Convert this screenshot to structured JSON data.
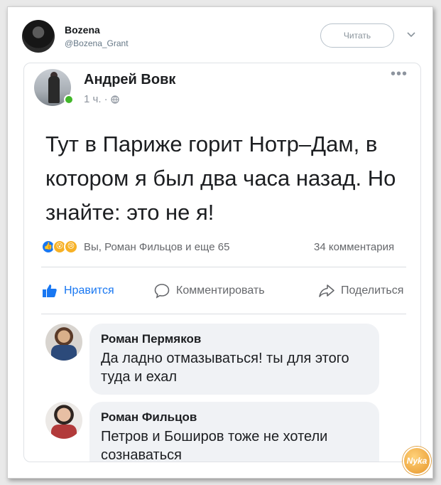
{
  "tweet": {
    "author_name": "Bozena",
    "author_handle": "@Bozena_Grant",
    "follow_label": "Читать"
  },
  "post": {
    "author": "Андрей Вовк",
    "time": "1 ч. ·",
    "text": "Тут в Париже горит Нотр–Дам, в котором я был два часа назад. Но знайте: это не я!",
    "reactions_summary": "Вы, Роман Фильцов и еще 65",
    "comments_count": "34 комментария",
    "actions": {
      "like": "Нравится",
      "comment": "Комментировать",
      "share": "Поделиться"
    }
  },
  "comments": [
    {
      "author": "Роман Пермяков",
      "text": "Да ладно отмазываться! ты для этого туда и ехал"
    },
    {
      "author": "Роман Фильцов",
      "text": "Петров и Боширов тоже не хотели сознаваться"
    }
  ],
  "watermark": "Nyka",
  "colors": {
    "accent": "#1877f2",
    "online": "#42b72a",
    "bubble": "#f0f2f5"
  },
  "icons": [
    "globe-icon",
    "more-icon",
    "like-icon",
    "comment-icon",
    "share-icon",
    "chevron-down-icon"
  ]
}
